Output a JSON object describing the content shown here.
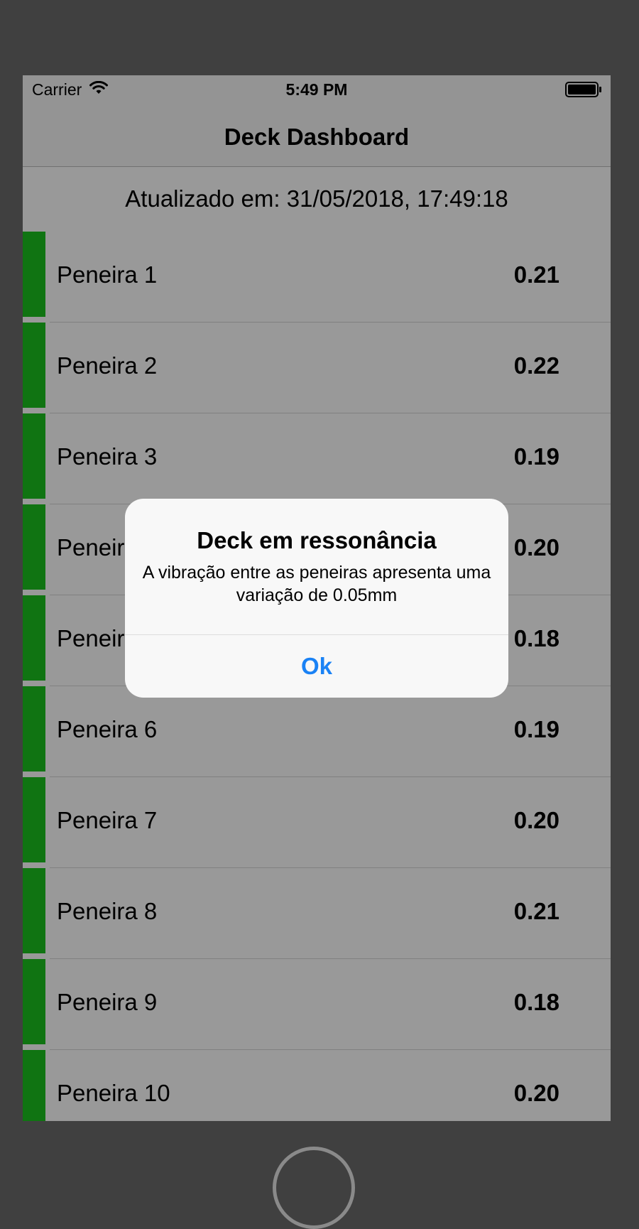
{
  "status_bar": {
    "carrier": "Carrier",
    "time": "5:49 PM",
    "wifi_icon": "wifi-icon",
    "battery_icon": "battery-icon"
  },
  "nav": {
    "title": "Deck Dashboard"
  },
  "updated_label": "Atualizado em: 31/05/2018, 17:49:18",
  "colors": {
    "status_ok": "#1bc11f",
    "accent": "#1a82f5"
  },
  "rows": [
    {
      "name": "Peneira 1",
      "value": "0.21"
    },
    {
      "name": "Peneira 2",
      "value": "0.22"
    },
    {
      "name": "Peneira 3",
      "value": "0.19"
    },
    {
      "name": "Peneir",
      "value": "0.20"
    },
    {
      "name": "Peneir",
      "value": "0.18"
    },
    {
      "name": "Peneira 6",
      "value": "0.19"
    },
    {
      "name": "Peneira 7",
      "value": "0.20"
    },
    {
      "name": "Peneira 8",
      "value": "0.21"
    },
    {
      "name": "Peneira 9",
      "value": "0.18"
    },
    {
      "name": "Peneira 10",
      "value": "0.20"
    }
  ],
  "alert": {
    "title": "Deck em ressonância",
    "message": "A vibração entre as peneiras apresenta uma variação de 0.05mm",
    "button": "Ok"
  }
}
